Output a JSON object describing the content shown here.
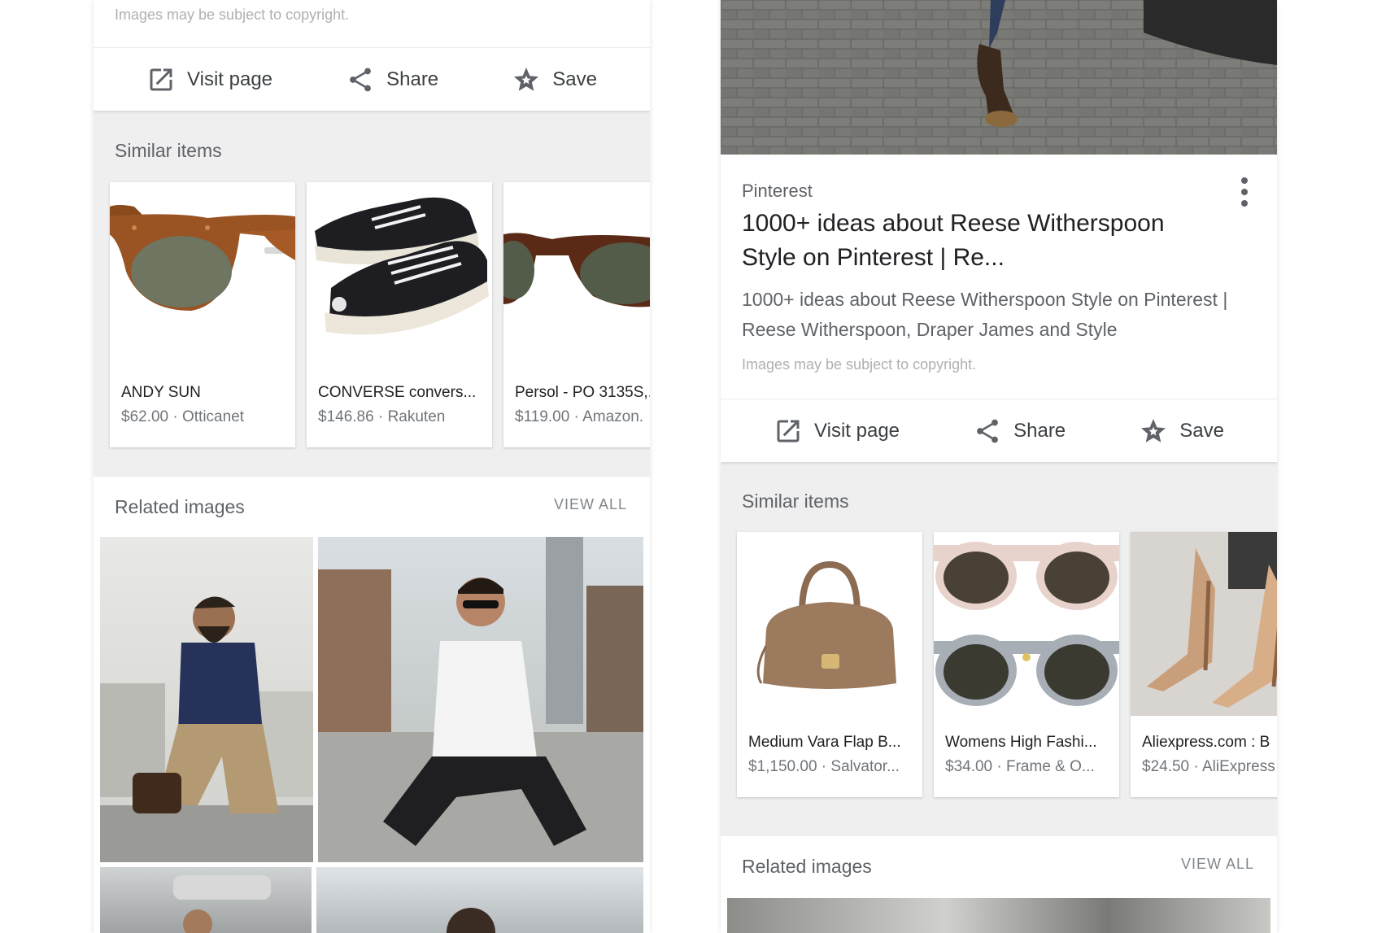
{
  "left_panel": {
    "copyright": "Images may be subject to copyright.",
    "actions": {
      "visit": "Visit page",
      "share": "Share",
      "save": "Save"
    },
    "similar_title": "Similar items",
    "similar_items": [
      {
        "name": "ANDY SUN",
        "price": "$62.00 · Otticanet"
      },
      {
        "name": "CONVERSE convers...",
        "price": "$146.86 · Rakuten"
      },
      {
        "name": "Persol - PO 3135S,...",
        "price": "$119.00 · Amazon."
      }
    ],
    "related_title": "Related images",
    "view_all": "VIEW ALL"
  },
  "right_panel": {
    "source": "Pinterest",
    "title": "1000+ ideas about Reese Witherspoon Style on Pinterest | Re...",
    "description": "1000+ ideas about Reese Witherspoon Style on Pinterest | Reese Witherspoon, Draper James and Style",
    "copyright": "Images may be subject to copyright.",
    "actions": {
      "visit": "Visit page",
      "share": "Share",
      "save": "Save"
    },
    "similar_title": "Similar items",
    "similar_items": [
      {
        "name": "Medium Vara Flap B...",
        "price": "$1,150.00 · Salvator..."
      },
      {
        "name": "Womens High Fashi...",
        "price": "$34.00 · Frame & O..."
      },
      {
        "name": "Aliexpress.com : B",
        "price": "$24.50 · AliExpress"
      }
    ],
    "related_title": "Related images",
    "view_all": "VIEW ALL"
  },
  "icons": {
    "visit": "open-in-new-icon",
    "share": "share-icon",
    "save": "star-save-icon",
    "more": "more-vert-icon"
  }
}
